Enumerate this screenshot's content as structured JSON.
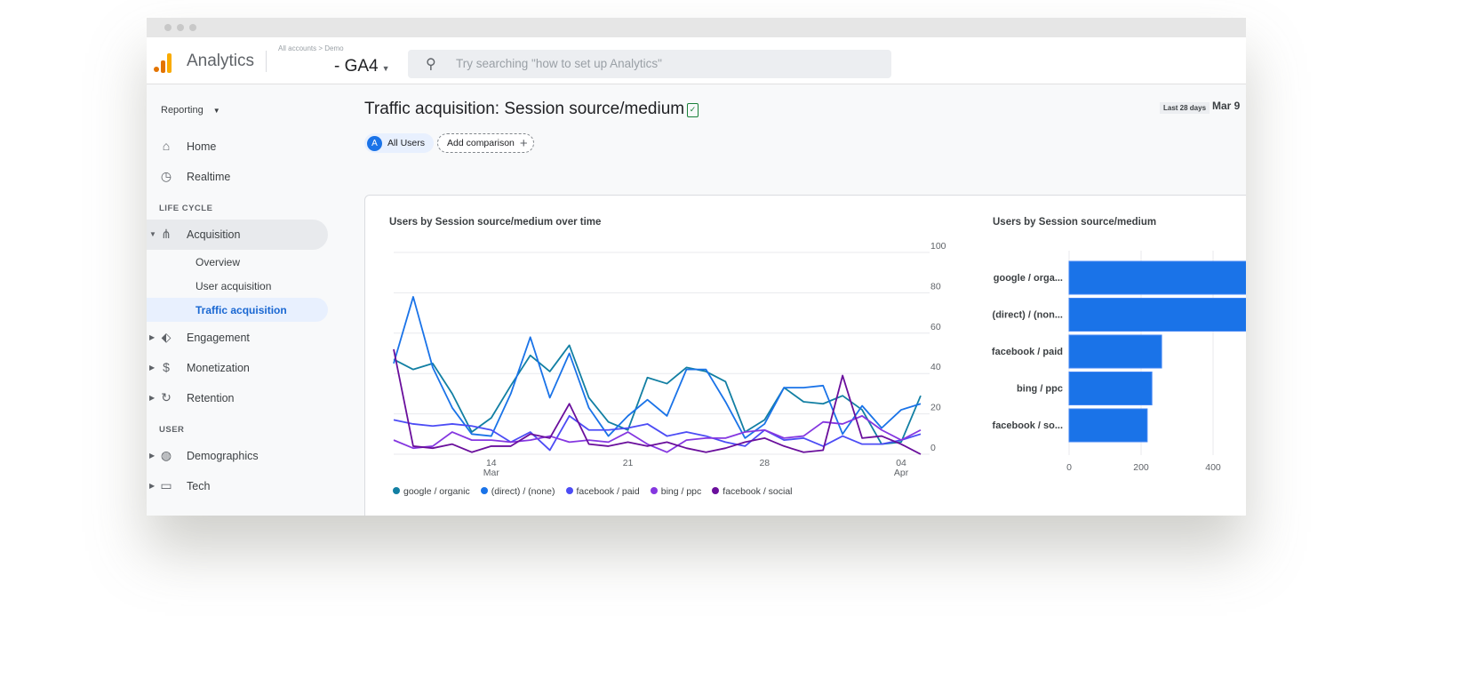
{
  "header": {
    "app_name": "Analytics",
    "account_path": "All accounts > Demo",
    "property": "- GA4",
    "search_placeholder": "Try searching \"how to set up Analytics\""
  },
  "sidebar": {
    "reporting": "Reporting",
    "items": [
      {
        "label": "Home",
        "icon": "home-icon"
      },
      {
        "label": "Realtime",
        "icon": "clock-icon"
      }
    ],
    "lifecycle_label": "LIFE CYCLE",
    "lifecycle": [
      {
        "label": "Acquisition",
        "icon": "acquisition-icon",
        "expanded": true
      },
      {
        "label": "Engagement",
        "icon": "tag-icon"
      },
      {
        "label": "Monetization",
        "icon": "dollar-icon"
      },
      {
        "label": "Retention",
        "icon": "retention-icon"
      }
    ],
    "acquisition_sub": [
      "Overview",
      "User acquisition",
      "Traffic acquisition"
    ],
    "user_label": "USER",
    "user": [
      {
        "label": "Demographics",
        "icon": "globe-icon"
      },
      {
        "label": "Tech",
        "icon": "devices-icon"
      }
    ]
  },
  "page": {
    "title": "Traffic acquisition: Session source/medium",
    "segment_letter": "A",
    "segment": "All Users",
    "add_comparison": "Add comparison",
    "date_label": "Last 28 days",
    "date_value": "Mar 9"
  },
  "colors": {
    "google_organic": "#127fa3",
    "direct": "#1a73e8",
    "facebook_paid": "#4c4cf5",
    "bing_ppc": "#8537e0",
    "facebook_social": "#6a0f9c",
    "bar": "#1a73e8"
  },
  "chart_data": [
    {
      "type": "line",
      "title": "Users by Session source/medium over time",
      "x_ticks": [
        "14\nMar",
        "21",
        "28",
        "04\nApr"
      ],
      "x_tick_labels": [
        [
          "14",
          "Mar"
        ],
        [
          "21",
          ""
        ],
        [
          "28",
          ""
        ],
        [
          "04",
          "Apr"
        ]
      ],
      "x_range": [
        "Mar 9",
        "Apr 5"
      ],
      "ylim": [
        0,
        100
      ],
      "y_ticks": [
        0,
        20,
        40,
        60,
        80,
        100
      ],
      "grid": true,
      "legend": "bottom",
      "series": [
        {
          "name": "google / organic",
          "values": [
            47,
            42,
            45,
            30,
            11,
            18,
            34,
            49,
            41,
            54,
            28,
            16,
            12,
            38,
            35,
            43,
            41,
            36,
            11,
            17,
            33,
            26,
            25,
            29,
            22,
            5,
            6,
            29
          ]
        },
        {
          "name": "(direct) / (none)",
          "values": [
            45,
            78,
            43,
            23,
            10,
            9,
            30,
            58,
            28,
            50,
            23,
            9,
            19,
            27,
            19,
            42,
            42,
            26,
            8,
            15,
            33,
            33,
            34,
            10,
            24,
            13,
            22,
            25
          ]
        },
        {
          "name": "facebook / paid",
          "values": [
            17,
            15,
            14,
            15,
            14,
            12,
            6,
            11,
            2,
            19,
            12,
            12,
            13,
            15,
            9,
            11,
            9,
            6,
            4,
            12,
            7,
            8,
            4,
            9,
            5,
            5,
            7,
            10
          ]
        },
        {
          "name": "bing / ppc",
          "values": [
            7,
            3,
            4,
            11,
            7,
            7,
            6,
            7,
            9,
            6,
            7,
            6,
            11,
            5,
            1,
            7,
            8,
            8,
            11,
            12,
            8,
            9,
            16,
            15,
            19,
            12,
            7,
            12
          ]
        },
        {
          "name": "facebook / social",
          "values": [
            52,
            4,
            3,
            5,
            1,
            4,
            4,
            10,
            8,
            25,
            5,
            4,
            6,
            4,
            6,
            3,
            1,
            3,
            6,
            8,
            4,
            1,
            2,
            39,
            8,
            9,
            5,
            0
          ]
        }
      ]
    },
    {
      "type": "bar",
      "orientation": "horizontal",
      "title": "Users by Session source/medium",
      "categories": [
        "google / orga...",
        "(direct) / (non...",
        "facebook / paid",
        "bing / ppc",
        "facebook / so..."
      ],
      "values": [
        520,
        510,
        257,
        230,
        217
      ],
      "x_ticks": [
        0,
        200,
        400
      ],
      "grid": true
    }
  ]
}
